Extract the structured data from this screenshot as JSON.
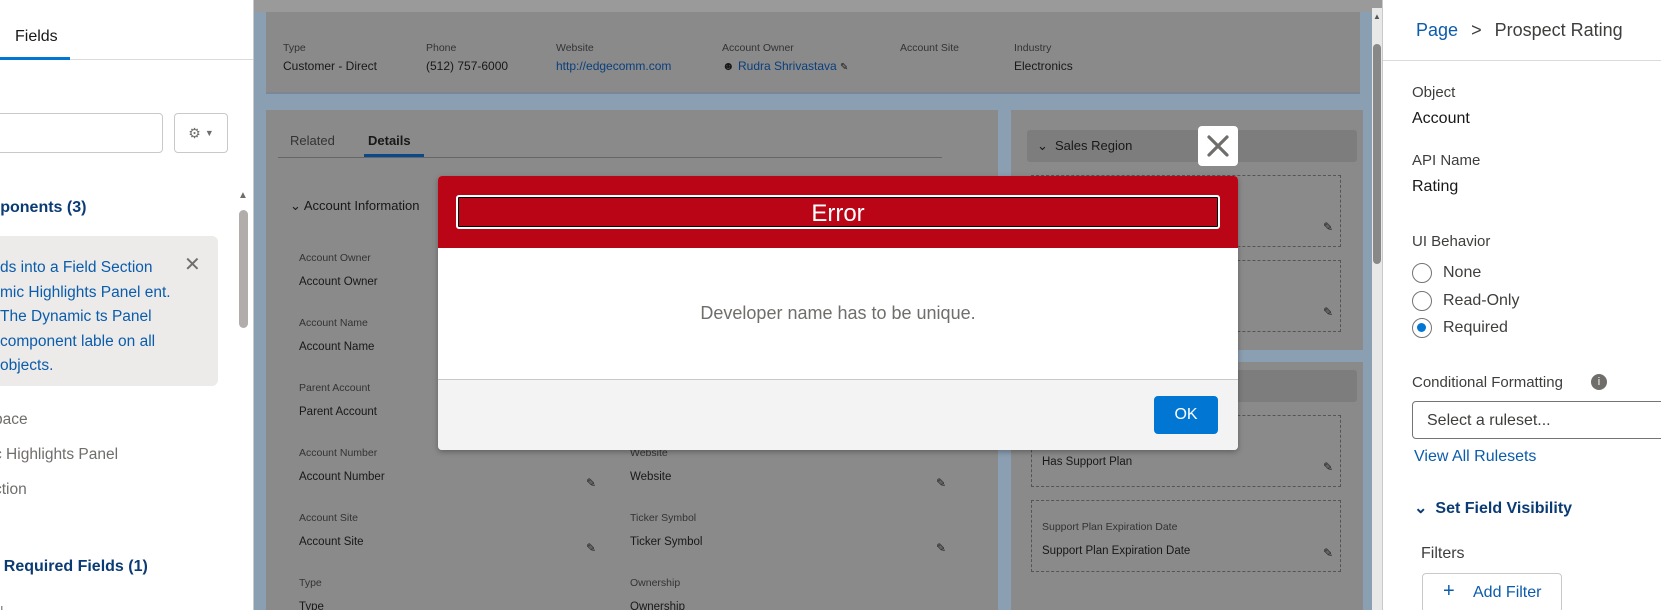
{
  "left_panel": {
    "tab_fields": "Fields",
    "components_heading": "mponents (3)",
    "info_text": "ds into a Field Section mic Highlights Panel ent. The Dynamic ts Panel component lable on all objects.",
    "items": [
      "pace",
      "c Highlights Panel",
      "ction"
    ],
    "required_heading": "ly Required Fields (1)",
    "cut_item": "N"
  },
  "highlights": {
    "fields": [
      {
        "label": "Type",
        "value": "Customer - Direct"
      },
      {
        "label": "Phone",
        "value": "(512) 757-6000"
      },
      {
        "label": "Website",
        "value": "http://edgecomm.com"
      },
      {
        "label": "Account Owner",
        "value": "Rudra Shrivastava"
      },
      {
        "label": "Account Site",
        "value": ""
      },
      {
        "label": "Industry",
        "value": "Electronics"
      }
    ]
  },
  "details": {
    "tab_related": "Related",
    "tab_details": "Details",
    "section_title": "Account Information",
    "left_fields": [
      {
        "label": "Account Owner",
        "value": "Account Owner"
      },
      {
        "label": "Account Name",
        "value": "Account Name"
      },
      {
        "label": "Parent Account",
        "value": "Parent Account"
      },
      {
        "label": "Account Number",
        "value": "Account Number"
      },
      {
        "label": "Account Site",
        "value": "Account Site"
      },
      {
        "label": "Type",
        "value": "Type"
      }
    ],
    "right_fields": [
      {
        "label": "Website",
        "value": "Website"
      },
      {
        "label": "Ticker Symbol",
        "value": "Ticker Symbol"
      },
      {
        "label": "Ownership",
        "value": "Ownership"
      }
    ]
  },
  "right_card": {
    "section_title": "Sales Region",
    "fields": [
      {
        "label": "",
        "value": "Has Support Plan"
      },
      {
        "label": "Support Plan Expiration Date",
        "value": "Support Plan Expiration Date"
      }
    ]
  },
  "properties": {
    "breadcrumb_page": "Page",
    "breadcrumb_sep": ">",
    "breadcrumb_current": "Prospect Rating",
    "object_label": "Object",
    "object_value": "Account",
    "api_label": "API Name",
    "api_value": "Rating",
    "ui_behavior_label": "UI Behavior",
    "options": [
      "None",
      "Read-Only",
      "Required"
    ],
    "selected_option": "Required",
    "conditional_label": "Conditional Formatting",
    "ruleset_placeholder": "Select a ruleset...",
    "view_rulesets": "View All Rulesets",
    "visibility_heading": "Set Field Visibility",
    "filters_label": "Filters",
    "add_filter": "Add Filter"
  },
  "modal": {
    "title": "Error",
    "message": "Developer name has to be unique.",
    "ok_label": "OK",
    "header_color": "#ba0517",
    "button_color": "#0176d3"
  }
}
